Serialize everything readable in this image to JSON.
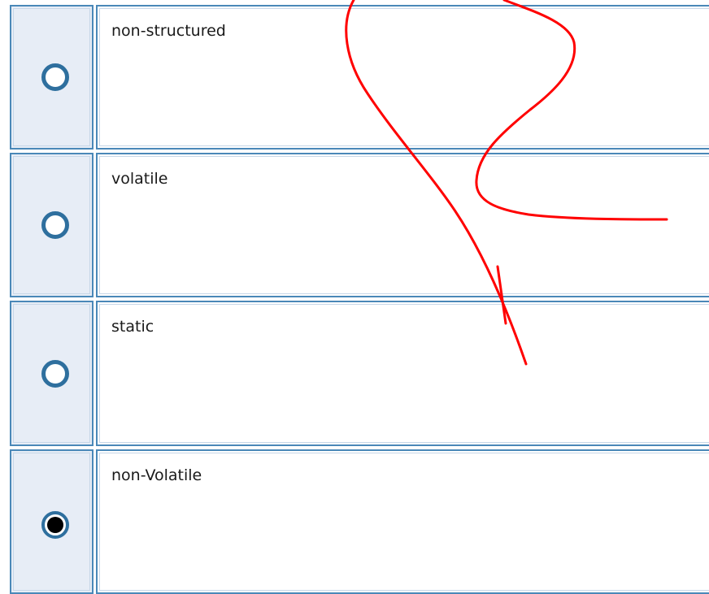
{
  "options": [
    {
      "label": "non-structured",
      "selected": false
    },
    {
      "label": "volatile",
      "selected": false
    },
    {
      "label": "static",
      "selected": false
    },
    {
      "label": "non-Volatile",
      "selected": true
    }
  ],
  "colors": {
    "border": "#4a88b8",
    "radio_cell_bg": "#e7edf6",
    "radio_ring": "#2e6f9e",
    "annotation": "#ff0000"
  },
  "annotation": {
    "type": "freehand-pen-mark"
  }
}
